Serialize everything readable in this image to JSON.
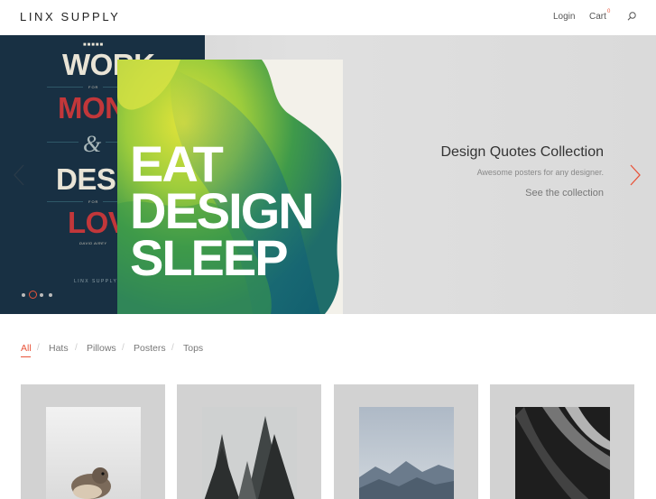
{
  "header": {
    "logo": "LINX SUPPLY",
    "login_label": "Login",
    "cart_label": "Cart",
    "cart_count": "0",
    "search_icon": "search-icon"
  },
  "hero": {
    "slide_title": "Design Quotes Collection",
    "slide_subtitle": "Awesome posters for any designer.",
    "slide_link": "See the collection",
    "prev_icon": "chevron-left-icon",
    "next_icon": "chevron-right-icon",
    "active_dot": 1,
    "dot_count": 4,
    "poster_left": {
      "work": "WORK",
      "for1": "FOR",
      "money": "MONEY",
      "amp": "&",
      "design": "DESIGN",
      "for2": "FOR",
      "love": "LOVE",
      "author": "DAVID AIREY",
      "brand": "LINX SUPPLY"
    },
    "poster_right": {
      "line1": "EAT",
      "line2": "DESIGN",
      "line3": "SLEEP"
    }
  },
  "filters": {
    "items": [
      "All",
      "Hats",
      "Pillows",
      "Posters",
      "Tops"
    ],
    "active": "All"
  },
  "colors": {
    "accent": "#e8543a",
    "poster_navy": "#183043",
    "poster_red": "#c2373a"
  }
}
